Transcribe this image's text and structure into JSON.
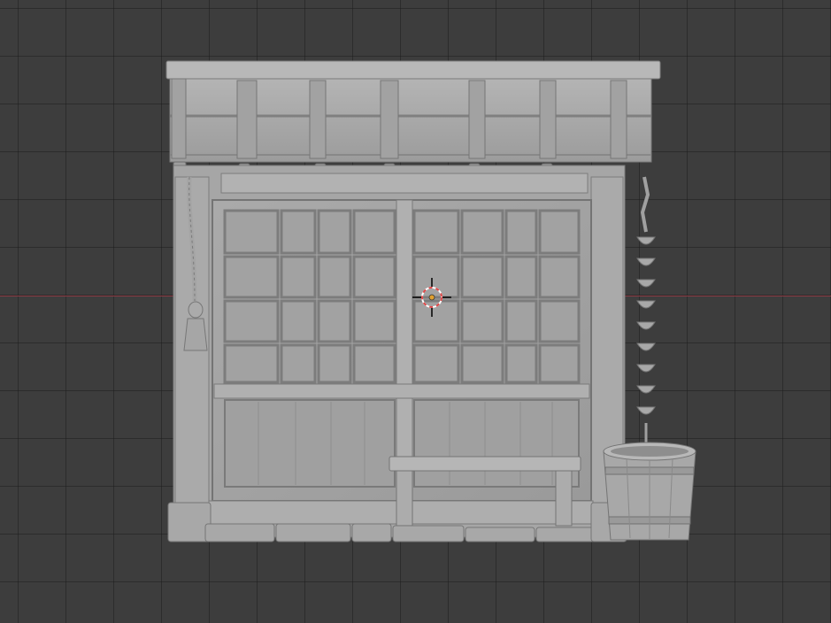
{
  "viewport": {
    "background_color": "#3d3d3d",
    "grid_line_color": "#2a2a2a",
    "x_axis_color": "#8c3a44"
  },
  "scene": {
    "object": "shop-front-sculpt",
    "material_color": "#a8a8a8",
    "shadow_color": "#7d7d7d",
    "highlight_color": "#c4c4c4"
  },
  "cursor_3d": {
    "ring_color_a": "#e04848",
    "ring_color_b": "#ffffff",
    "origin_color": "#e0a030"
  }
}
